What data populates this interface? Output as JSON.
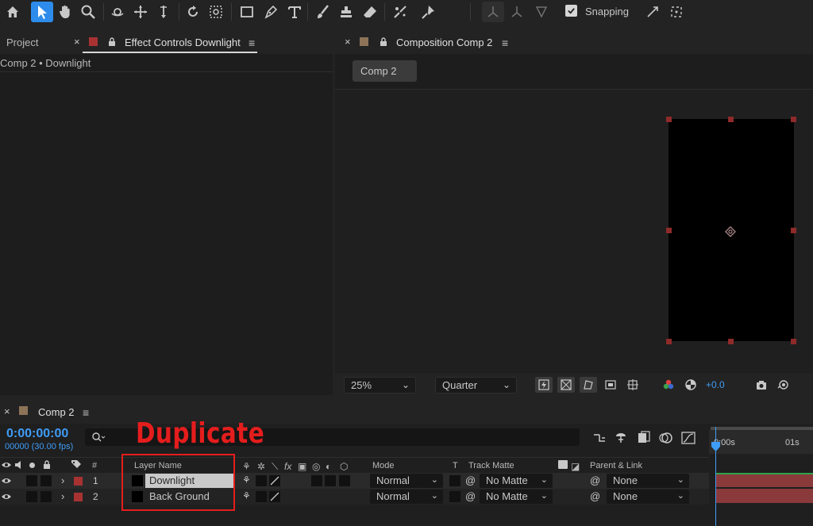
{
  "toolbar": {
    "snapping_label": "Snapping",
    "snapping_checked": true,
    "active_tool": "selection"
  },
  "left_panel": {
    "tab_project": "Project",
    "tab_effect_controls": "Effect Controls Downlight",
    "breadcrumb": "Comp 2 • Downlight",
    "label_color": "#a83232"
  },
  "comp_panel": {
    "tab_label": "Composition Comp 2",
    "comp_chip": "Comp 2",
    "label_color": "#8d7458",
    "zoom": "25%",
    "resolution": "Quarter",
    "exposure": "+0.0"
  },
  "timeline": {
    "tab_label": "Comp 2",
    "timecode": "0:00:00:00",
    "fps": "00000 (30.00 fps)",
    "annotation": "Duplicate",
    "ruler_start": "0:00s",
    "ruler_mark": "01s",
    "columns": {
      "index": "#",
      "layer_name": "Layer Name",
      "mode": "Mode",
      "t": "T",
      "track_matte": "Track Matte",
      "parent_link": "Parent & Link"
    },
    "layers": [
      {
        "index": "1",
        "name": "Downlight",
        "mode": "Normal",
        "track_matte": "No Matte",
        "parent": "None",
        "color": "#a83232"
      },
      {
        "index": "2",
        "name": "Back Ground",
        "mode": "Normal",
        "track_matte": "No Matte",
        "parent": "None",
        "color": "#a83232"
      }
    ]
  }
}
